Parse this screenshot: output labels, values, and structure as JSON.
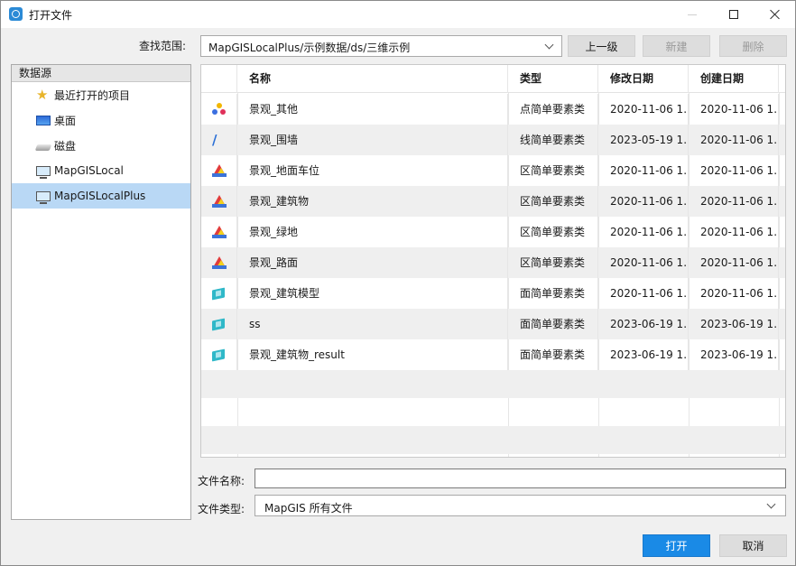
{
  "window": {
    "title": "打开文件"
  },
  "toolbar": {
    "lookin_label": "查找范围:",
    "lookin_value": "MapGISLocalPlus/示例数据/ds/三维示例",
    "up_label": "上一级",
    "new_label": "新建",
    "delete_label": "删除"
  },
  "sidebar": {
    "header": "数据源",
    "items": [
      {
        "label": "最近打开的项目",
        "icon": "star-icon"
      },
      {
        "label": "桌面",
        "icon": "desktop-icon"
      },
      {
        "label": "磁盘",
        "icon": "disk-icon"
      },
      {
        "label": "MapGISLocal",
        "icon": "computer-icon"
      },
      {
        "label": "MapGISLocalPlus",
        "icon": "computer-icon",
        "selected": true
      }
    ]
  },
  "grid": {
    "columns": [
      "名称",
      "类型",
      "修改日期",
      "创建日期"
    ],
    "rows": [
      {
        "icon": "point-layer-icon",
        "name": "景观_其他",
        "type": "点简单要素类",
        "modified": "2020-11-06 1...",
        "created": "2020-11-06 1..."
      },
      {
        "icon": "line-layer-icon",
        "name": "景观_围墙",
        "type": "线简单要素类",
        "modified": "2023-05-19 1...",
        "created": "2020-11-06 1..."
      },
      {
        "icon": "region-layer-icon",
        "name": "景观_地面车位",
        "type": "区简单要素类",
        "modified": "2020-11-06 1...",
        "created": "2020-11-06 1..."
      },
      {
        "icon": "region-layer-icon",
        "name": "景观_建筑物",
        "type": "区简单要素类",
        "modified": "2020-11-06 1...",
        "created": "2020-11-06 1..."
      },
      {
        "icon": "region-layer-icon",
        "name": "景观_绿地",
        "type": "区简单要素类",
        "modified": "2020-11-06 1...",
        "created": "2020-11-06 1..."
      },
      {
        "icon": "region-layer-icon",
        "name": "景观_路面",
        "type": "区简单要素类",
        "modified": "2020-11-06 1...",
        "created": "2020-11-06 1..."
      },
      {
        "icon": "surface-layer-icon",
        "name": "景观_建筑模型",
        "type": "面简单要素类",
        "modified": "2020-11-06 1...",
        "created": "2020-11-06 1..."
      },
      {
        "icon": "surface-layer-icon",
        "name": "ss",
        "type": "面简单要素类",
        "modified": "2023-06-19 1...",
        "created": "2023-06-19 1..."
      },
      {
        "icon": "surface-layer-icon",
        "name": "景观_建筑物_result",
        "type": "面简单要素类",
        "modified": "2023-06-19 1...",
        "created": "2023-06-19 1..."
      }
    ]
  },
  "form": {
    "filename_label": "文件名称:",
    "filename_value": "",
    "filetype_label": "文件类型:",
    "filetype_value": "MapGIS 所有文件"
  },
  "buttons": {
    "open_label": "打开",
    "cancel_label": "取消"
  },
  "colors": {
    "accent": "#1a8ae6",
    "selection": "#b9d8f5"
  }
}
